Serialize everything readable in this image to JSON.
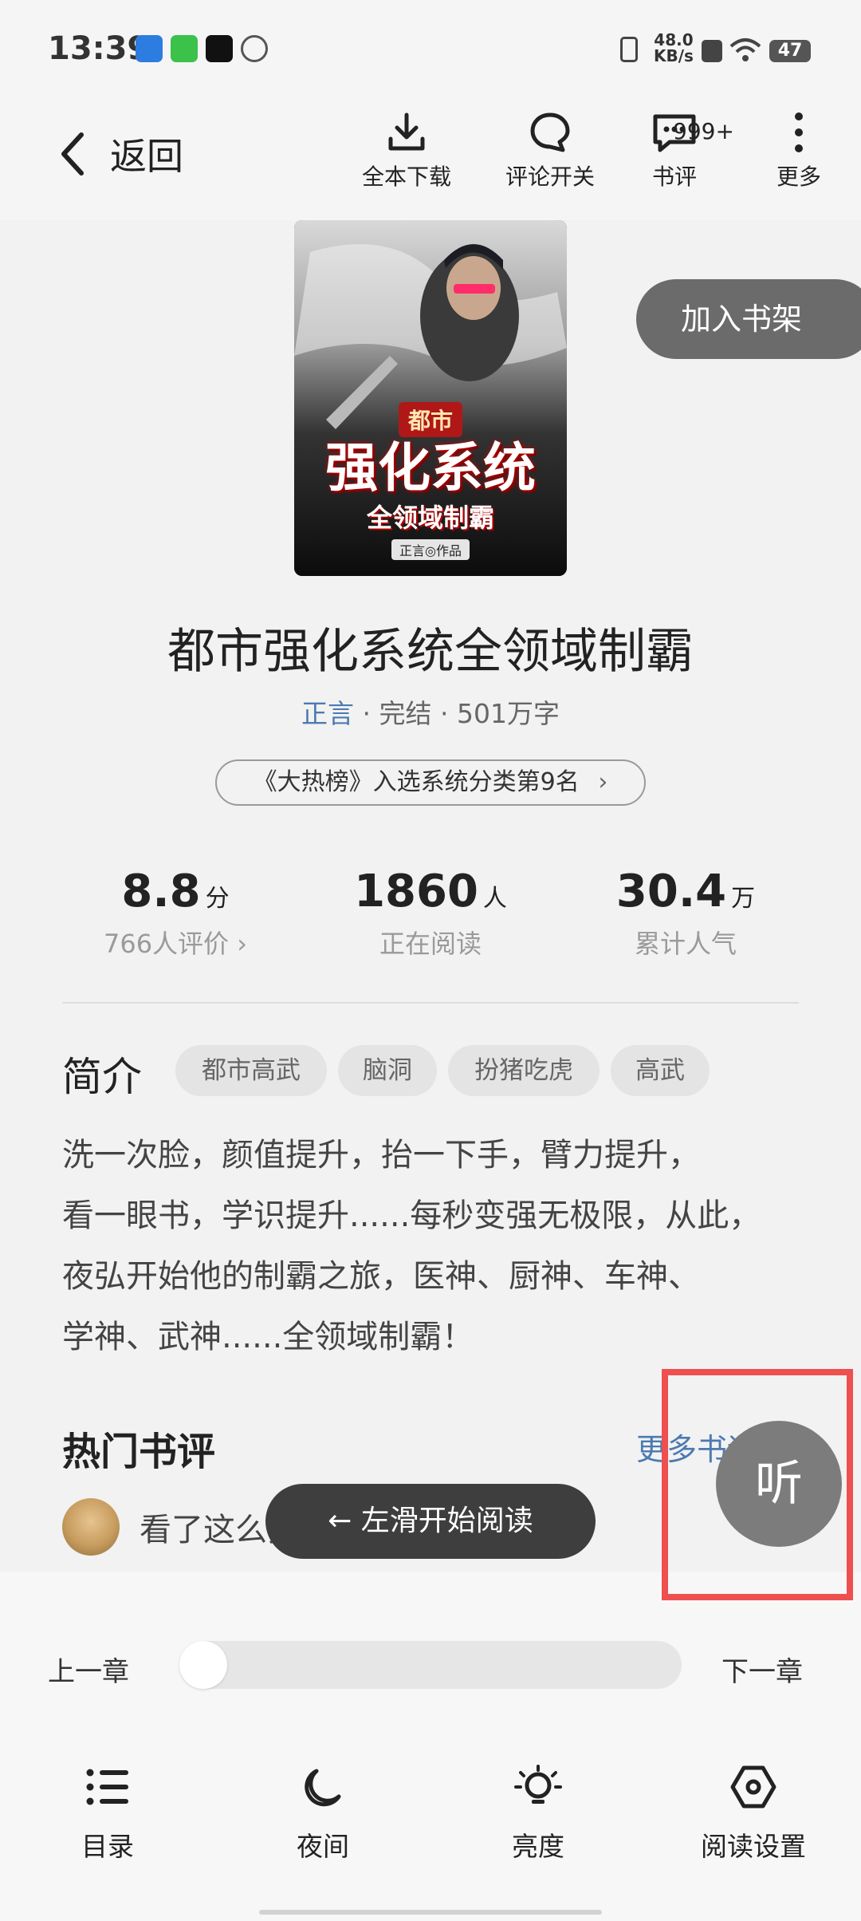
{
  "status_bar": {
    "time": "13:39",
    "net_speed": "48.0",
    "net_unit": "KB/s",
    "battery": "47"
  },
  "header": {
    "back_label": "返回",
    "download_label": "全本下载",
    "comment_toggle_label": "评论开关",
    "review_label": "书评",
    "review_count": "999+",
    "more_label": "更多"
  },
  "book": {
    "cover_tag": "都市",
    "cover_title": "强化系统",
    "cover_subtitle": "全领域制霸",
    "cover_author": "正言◎作品",
    "add_shelf": "加入书架",
    "title": "都市强化系统全领域制霸",
    "author": "正言",
    "state": "完结",
    "words": "501万字",
    "rank_text": "《大热榜》入选系统分类第9名"
  },
  "stats": [
    {
      "value": "8.8",
      "unit": "分",
      "label": "766人评价 ›"
    },
    {
      "value": "1860",
      "unit": "人",
      "label": "正在阅读"
    },
    {
      "value": "30.4",
      "unit": "万",
      "label": "累计人气"
    }
  ],
  "intro": {
    "heading": "简介",
    "tags": [
      "都市高武",
      "脑洞",
      "扮猪吃虎",
      "高武"
    ],
    "lines": [
      "洗一次脸，颜值提升，抬一下手，臂力提升，",
      "看一眼书，学识提升......每秒变强无极限，从此，",
      "夜弘开始他的制霸之旅，医神、厨神、车神、",
      "学神、武神......全领域制霸！"
    ]
  },
  "reviews": {
    "heading": "热门书评",
    "more": "更多书评",
    "first_text": "看了这么多书，还能让我沉迷"
  },
  "overlay": {
    "swipe_hint": "← 左滑开始阅读",
    "listen": "听"
  },
  "panel": {
    "prev_chapter": "上一章",
    "next_chapter": "下一章",
    "progress": 0,
    "tools": [
      "目录",
      "夜间",
      "亮度",
      "阅读设置"
    ]
  },
  "colors": {
    "accent": "#4c7ab0",
    "highlight_box": "#ee4f4f"
  }
}
